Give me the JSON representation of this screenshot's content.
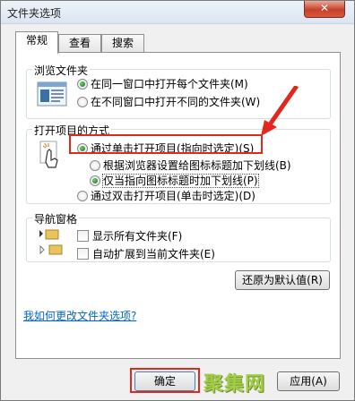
{
  "window": {
    "title": "文件夹选项",
    "close_label": "✕"
  },
  "tabs": [
    {
      "label": "常规",
      "active": true
    },
    {
      "label": "查看",
      "active": false
    },
    {
      "label": "搜索",
      "active": false
    }
  ],
  "browse": {
    "label": "浏览文件夹",
    "opt_same": "在同一窗口中打开每个文件夹(M)",
    "opt_new": "在不同窗口中打开不同的文件夹(W)"
  },
  "click": {
    "label": "打开项目的方式",
    "opt_single": "通过单击打开项目(指向时选定)(S)",
    "sub_browser": "根据浏览器设置给图标标题加下划线(B)",
    "sub_hover": "仅当指向图标标题时加下划线(P)",
    "opt_double": "通过双击打开项目(单击时选定)(D)"
  },
  "nav": {
    "label": "导航窗格",
    "show_all": "显示所有文件夹(F)",
    "auto_expand": "自动扩展到当前文件夹(E)"
  },
  "restore_label": "还原为默认值(R)",
  "help_link": "我如何更改文件夹选项?",
  "footer": {
    "ok": "确定",
    "apply": "应用(A)"
  },
  "watermark": "聚集网",
  "colors": {
    "highlight": "#e0281c",
    "link": "#0066cc"
  }
}
